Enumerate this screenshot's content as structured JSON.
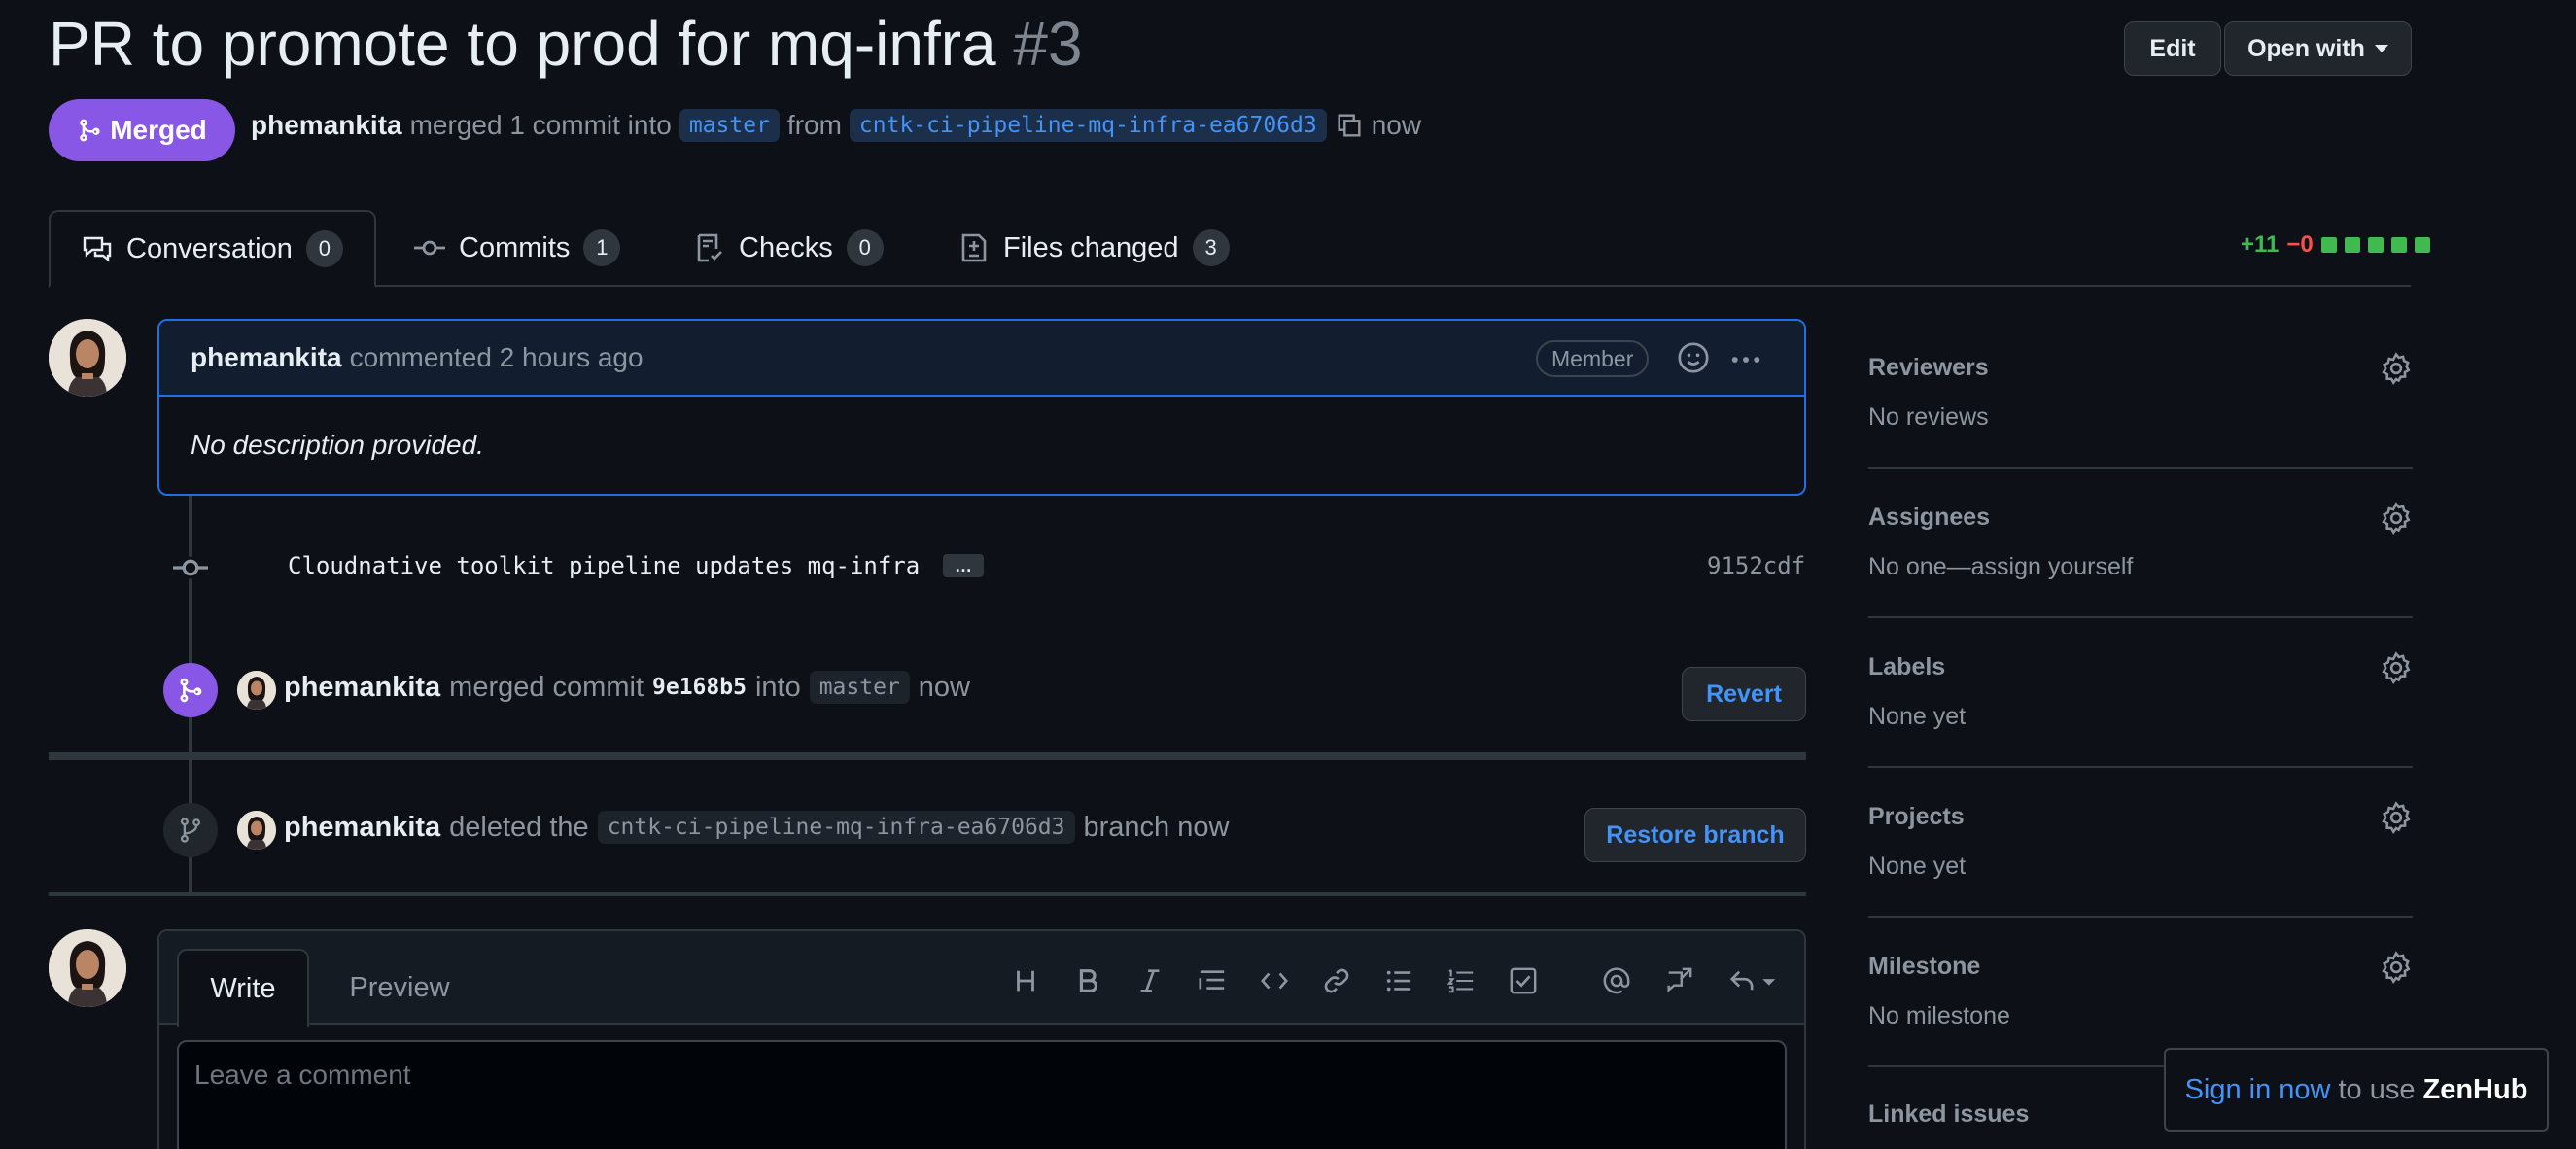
{
  "pr": {
    "title": "PR to promote to prod for mq-infra",
    "number": "#3",
    "state": "Merged",
    "author": "phemankita",
    "merge_text": "merged 1 commit into",
    "base_branch": "master",
    "from_text": "from",
    "head_branch": "cntk-ci-pipeline-mq-infra-ea6706d3",
    "time": "now"
  },
  "header_buttons": {
    "edit": "Edit",
    "open_with": "Open with"
  },
  "tabs": [
    {
      "label": "Conversation",
      "count": "0"
    },
    {
      "label": "Commits",
      "count": "1"
    },
    {
      "label": "Checks",
      "count": "0"
    },
    {
      "label": "Files changed",
      "count": "3"
    }
  ],
  "diffstat": {
    "additions": "+11",
    "deletions": "−0"
  },
  "comment": {
    "author": "phemankita",
    "action": "commented 2 hours ago",
    "role": "Member",
    "body": "No description provided."
  },
  "commit": {
    "message": "Cloudnative toolkit pipeline updates mq-infra",
    "ellipsis": "…",
    "sha": "9152cdf"
  },
  "merge_event": {
    "actor": "phemankita",
    "text1": "merged commit",
    "sha": "9e168b5",
    "text2": "into",
    "branch": "master",
    "time": "now",
    "button": "Revert"
  },
  "delete_event": {
    "actor": "phemankita",
    "text1": "deleted the",
    "branch": "cntk-ci-pipeline-mq-infra-ea6706d3",
    "text2": "branch now",
    "button": "Restore branch"
  },
  "compose": {
    "write_tab": "Write",
    "preview_tab": "Preview",
    "placeholder": "Leave a comment"
  },
  "sidebar": [
    {
      "title": "Reviewers",
      "value": "No reviews"
    },
    {
      "title": "Assignees",
      "value": "No one—assign yourself"
    },
    {
      "title": "Labels",
      "value": "None yet"
    },
    {
      "title": "Projects",
      "value": "None yet"
    },
    {
      "title": "Milestone",
      "value": "No milestone"
    },
    {
      "title": "Linked issues",
      "value": ""
    }
  ],
  "zenhub": {
    "link": "Sign in now",
    "text": "to use",
    "brand": "ZenHub"
  },
  "colors": {
    "merged": "#8957e5",
    "link": "#4493f8",
    "accent_border": "#1f6feb",
    "added": "#3fb950",
    "removed": "#f85149"
  }
}
